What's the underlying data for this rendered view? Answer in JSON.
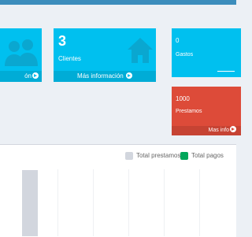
{
  "boxes": {
    "box1": {
      "footer": "ón"
    },
    "clientes": {
      "value": "3",
      "label": "Clientes",
      "footer": "Más información"
    },
    "gastos": {
      "value": "0",
      "label": "Gastos"
    },
    "prestamos": {
      "value": "1000",
      "label": "Prestamos",
      "footer": "Mas info"
    }
  },
  "legend": {
    "total_prestamos": "Total prestamos",
    "total_pagos": "Total pagos"
  },
  "colors": {
    "cyan": "#00c0ef",
    "red": "#dd4b39",
    "prestamos_series": "#d2d6de",
    "pagos_series": "#00a65a"
  },
  "icons": {
    "box1": "users-icon",
    "clientes": "home-icon",
    "footer_arrow": "arrow-circle-right-icon"
  }
}
